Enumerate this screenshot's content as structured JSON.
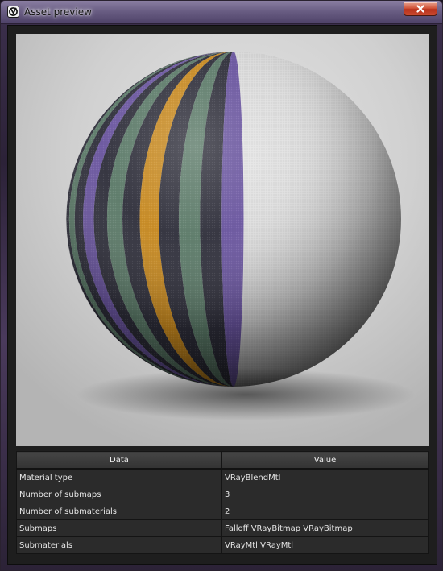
{
  "window": {
    "title": "Asset preview"
  },
  "table": {
    "headers": {
      "data": "Data",
      "value": "Value"
    },
    "rows": [
      {
        "label": "Material type",
        "value": "VRayBlendMtl"
      },
      {
        "label": "Number of submaps",
        "value": "3"
      },
      {
        "label": "Number of submaterials",
        "value": "2"
      },
      {
        "label": "Submaps",
        "value": "Falloff VRayBitmap VRayBitmap"
      },
      {
        "label": "Submaterials",
        "value": "VRayMtl VRayMtl"
      }
    ]
  },
  "preview": {
    "stripe_colors": {
      "dark": "#2e2e3a",
      "green": "#5b7a68",
      "purple": "#6a55a0",
      "orange": "#c8891e"
    }
  },
  "icons": {
    "app": "vray-logo-icon",
    "close": "close-icon"
  }
}
